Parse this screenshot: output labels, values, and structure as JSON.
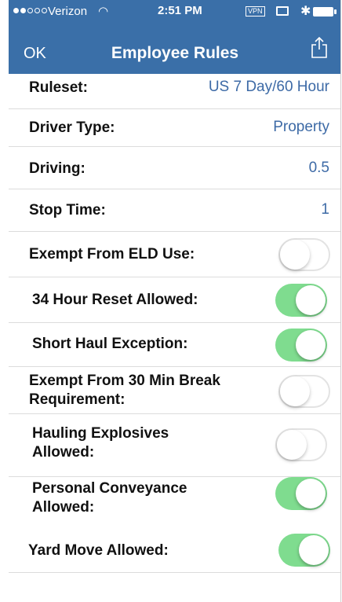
{
  "status_bar": {
    "carrier": "Verizon",
    "time": "2:51 PM",
    "vpn": "VPN",
    "signal_bars_filled": 2,
    "signal_bars_total": 5
  },
  "nav": {
    "left_button": "OK",
    "title": "Employee Rules",
    "right_icon": "share-icon"
  },
  "rows": [
    {
      "label": "Ruleset:",
      "value": "US 7 Day/60 Hour"
    },
    {
      "label": "Driver Type:",
      "value": "Property"
    },
    {
      "label": "Driving:",
      "value": "0.5"
    },
    {
      "label": "Stop Time:",
      "value": "1"
    },
    {
      "label": "Exempt From ELD Use:",
      "on": false
    },
    {
      "label": "34 Hour Reset Allowed:",
      "on": true
    },
    {
      "label": "Short Haul Exception:",
      "on": true
    },
    {
      "label": "Exempt From 30 Min Break Requirement:",
      "on": false
    },
    {
      "label": "Hauling Explosives Allowed:",
      "on": false
    },
    {
      "label": "Personal Conveyance Allowed:",
      "on": true
    },
    {
      "label": "Yard Move Allowed:",
      "on": true
    }
  ],
  "colors": {
    "header": "#3a6fa8",
    "value_text": "#3d6aa6",
    "toggle_on": "#7fdc8f"
  }
}
